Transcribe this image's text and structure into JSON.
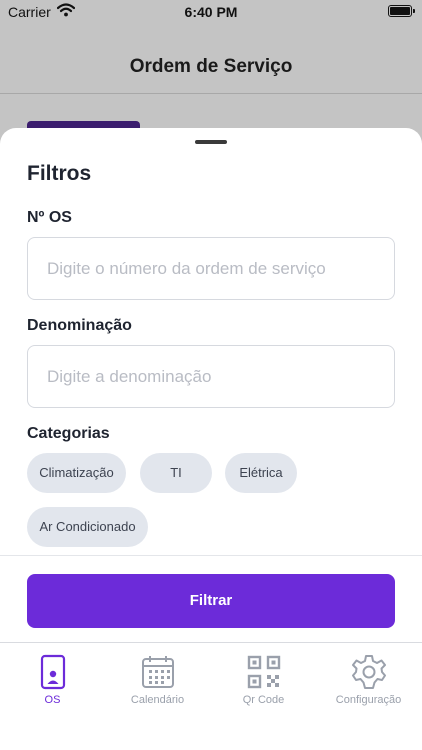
{
  "status_bar": {
    "carrier": "Carrier",
    "time": "6:40 PM"
  },
  "background": {
    "title": "Ordem de Serviço"
  },
  "sheet": {
    "title": "Filtros",
    "os_number": {
      "label": "Nº OS",
      "placeholder": "Digite o número da ordem de serviço",
      "value": ""
    },
    "denomination": {
      "label": "Denominação",
      "placeholder": "Digite a denominação",
      "value": ""
    },
    "categories": {
      "label": "Categorias",
      "items": [
        "Climatização",
        "TI",
        "Elétrica",
        "Ar Condicionado"
      ]
    },
    "filter_button": "Filtrar"
  },
  "tabbar": {
    "tabs": [
      {
        "label": "OS",
        "icon": "phone-user-icon",
        "active": true
      },
      {
        "label": "Calendário",
        "icon": "calendar-icon",
        "active": false
      },
      {
        "label": "Qr Code",
        "icon": "qr-code-icon",
        "active": false
      },
      {
        "label": "Configuração",
        "icon": "gear-icon",
        "active": false
      }
    ]
  },
  "colors": {
    "accent": "#6c2bd9",
    "chip_bg": "#e2e6ed",
    "inactive_tab": "#9aa0ab"
  }
}
